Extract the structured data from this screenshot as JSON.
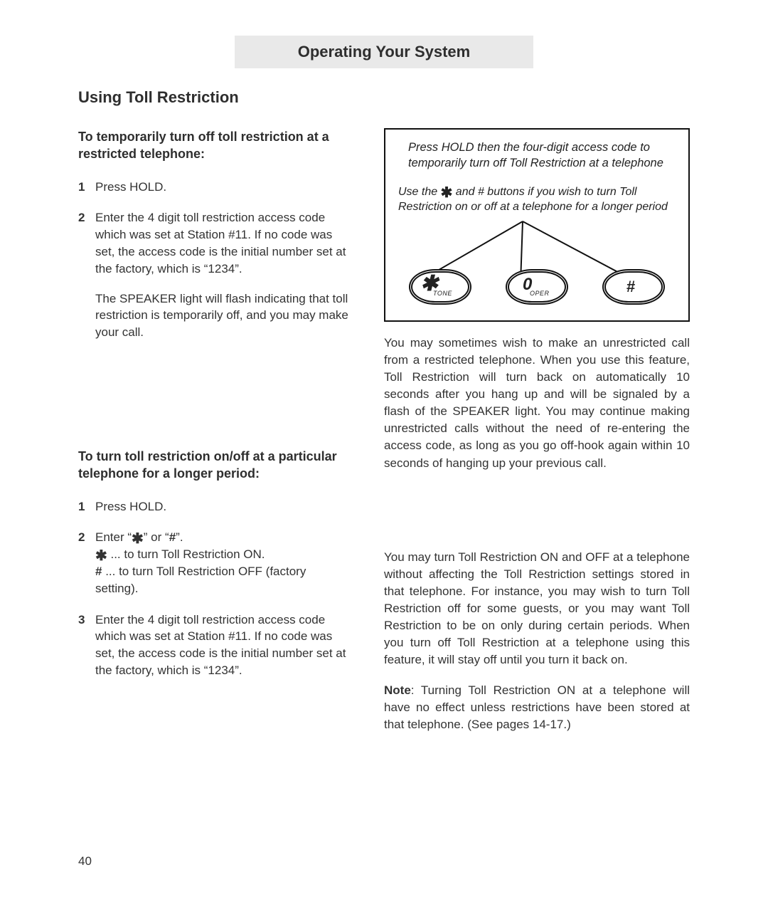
{
  "header": "Operating Your System",
  "section_title": "Using Toll Restriction",
  "left": {
    "subhead1": "To temporarily turn off toll restriction at a restricted telephone:",
    "list1": {
      "n1": "1",
      "t1": "Press HOLD.",
      "n2": "2",
      "t2a": "Enter the 4 digit toll restriction access code which was set at Station #11.  If no code was set, the access code is the initial number set at the factory, which is “1234”.",
      "t2b": "The SPEAKER light will flash indicating that toll restriction is temporarily off, and you may make your call."
    },
    "subhead2": "To turn toll restriction on/off at a particular telephone for a longer period:",
    "list2": {
      "n1": "1",
      "t1": "Press HOLD.",
      "n2": "2",
      "t2_pre": "Enter “",
      "t2_mid": "” or “",
      "t2_hash": "#",
      "t2_post": "”.",
      "t2_line2_post": " ... to turn Toll Restriction ON.",
      "t2_line3_pre": "#",
      "t2_line3_post": " ... to turn Toll Restriction OFF (factory setting).",
      "n3": "3",
      "t3": "Enter the 4 digit toll restriction access code which was set at Station #11.  If no code was set, the access code is the initial number set at the factory, which is “1234”."
    }
  },
  "right": {
    "box": {
      "top": "Press HOLD then the four-digit access code to temporarily turn off Toll Restriction at a telephone",
      "mid_pre": "Use the ",
      "mid_post": " and # buttons if you wish to turn Toll Restriction on or off at a telephone for a longer period",
      "keys": {
        "star_sub": "TONE",
        "zero": "0",
        "zero_sub": "OPER",
        "hash": "#"
      }
    },
    "p1": "You may sometimes wish to make an unrestricted call from a restricted telephone.  When you use this feature, Toll Restriction will turn back on automatically 10 seconds after you hang up and will be signaled by a flash of the SPEAKER light. You may continue making unrestricted calls without the need of re-entering the access code, as long as you go off-hook again within 10 seconds of hanging up your previous call.",
    "p2": "You may turn Toll Restriction ON and OFF at a telephone without affecting the Toll Restriction settings stored in that telephone.  For instance, you may wish to turn Toll Restriction off for some guests, or you may want Toll Restriction to be on only during certain periods.  When you turn off Toll Restriction at a telephone using this feature, it will stay off until you turn it back on.",
    "note_label": "Note",
    "note_body": ": Turning Toll Restriction ON at a telephone will have no effect unless restrictions have been stored at that telephone. (See pages 14-17.)"
  },
  "page_number": "40"
}
